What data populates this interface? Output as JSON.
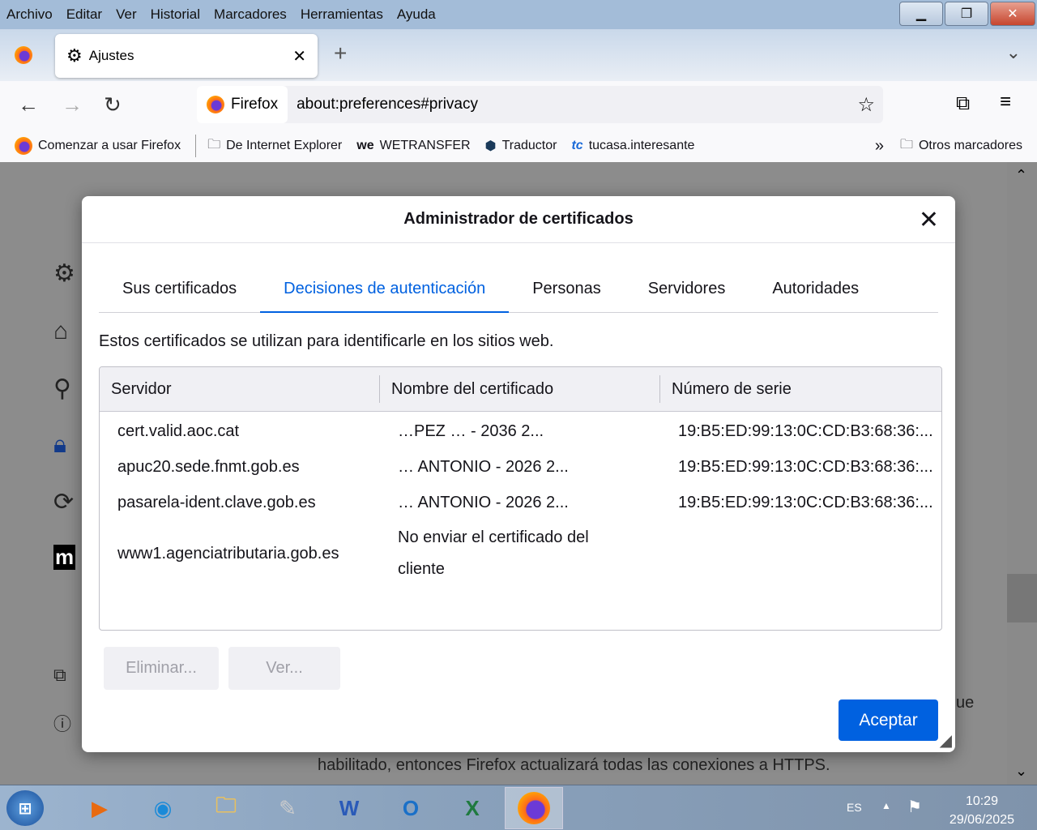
{
  "menu": [
    "Archivo",
    "Editar",
    "Ver",
    "Historial",
    "Marcadores",
    "Herramientas",
    "Ayuda"
  ],
  "tab": {
    "label": "Ajustes"
  },
  "url": {
    "identity": "Firefox",
    "value": "about:preferences#privacy"
  },
  "bookmarks": [
    "Comenzar a usar Firefox",
    "De Internet Explorer",
    "WETRANSFER",
    "Traductor",
    "tucasa.interesante"
  ],
  "other_bookmarks": "Otros marcadores",
  "background_text": "habilitado, entonces Firefox actualizará todas las conexiones a HTTPS.",
  "background_fragment": "ue",
  "dialog": {
    "title": "Administrador de certificados",
    "tabs": [
      "Sus certificados",
      "Decisiones de autenticación",
      "Personas",
      "Servidores",
      "Autoridades"
    ],
    "active_tab": 1,
    "description": "Estos certificados se utilizan para identificarle en los sitios web.",
    "columns": [
      "Servidor",
      "Nombre del certificado",
      "Número de serie"
    ],
    "rows": [
      {
        "server": "cert.valid.aoc.cat",
        "cert": "…PEZ … - 2036 2...",
        "serial": "19:B5:ED:99:13:0C:CD:B3:68:36:..."
      },
      {
        "server": "apuc20.sede.fnmt.gob.es",
        "cert": "… ANTONIO - 2026 2...",
        "serial": "19:B5:ED:99:13:0C:CD:B3:68:36:..."
      },
      {
        "server": "pasarela-ident.clave.gob.es",
        "cert": "… ANTONIO - 2026 2...",
        "serial": "19:B5:ED:99:13:0C:CD:B3:68:36:..."
      },
      {
        "server": "www1.agenciatributaria.gob.es",
        "cert": "No enviar el certificado del cliente",
        "serial": ""
      }
    ],
    "delete_button": "Eliminar...",
    "view_button": "Ver...",
    "accept_button": "Aceptar"
  },
  "taskbar": {
    "lang": "ES",
    "time": "10:29",
    "date": "29/06/2025"
  },
  "colors": {
    "accent": "#0061e0"
  }
}
